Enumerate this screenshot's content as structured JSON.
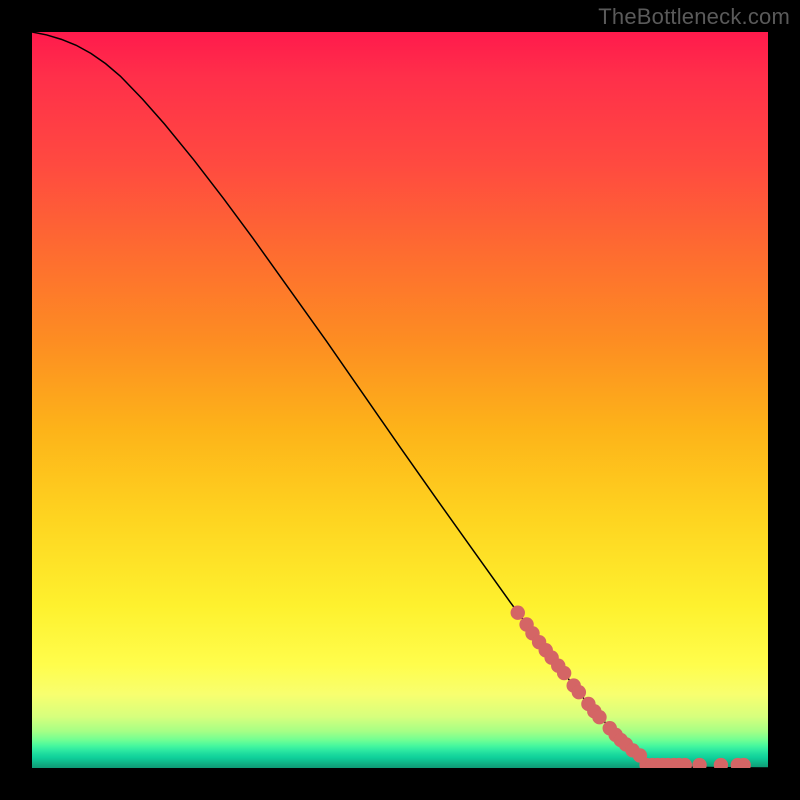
{
  "watermark": "TheBottleneck.com",
  "colors": {
    "dot": "#d46565",
    "line": "#000000",
    "background_black": "#000000"
  },
  "chart_data": {
    "type": "line",
    "title": "",
    "xlabel": "",
    "ylabel": "",
    "xlim": [
      0,
      100
    ],
    "ylim": [
      0,
      100
    ],
    "curve_points": [
      {
        "x": 0,
        "y": 100
      },
      {
        "x": 2,
        "y": 99.6
      },
      {
        "x": 4,
        "y": 99.0
      },
      {
        "x": 6,
        "y": 98.2
      },
      {
        "x": 8,
        "y": 97.1
      },
      {
        "x": 10,
        "y": 95.7
      },
      {
        "x": 12,
        "y": 94.0
      },
      {
        "x": 15,
        "y": 90.9
      },
      {
        "x": 18,
        "y": 87.5
      },
      {
        "x": 22,
        "y": 82.6
      },
      {
        "x": 26,
        "y": 77.4
      },
      {
        "x": 30,
        "y": 72.0
      },
      {
        "x": 35,
        "y": 65.0
      },
      {
        "x": 40,
        "y": 58.0
      },
      {
        "x": 45,
        "y": 50.8
      },
      {
        "x": 50,
        "y": 43.6
      },
      {
        "x": 55,
        "y": 36.5
      },
      {
        "x": 60,
        "y": 29.5
      },
      {
        "x": 65,
        "y": 22.5
      },
      {
        "x": 70,
        "y": 15.8
      },
      {
        "x": 75,
        "y": 9.4
      },
      {
        "x": 80,
        "y": 3.8
      },
      {
        "x": 82,
        "y": 2.0
      },
      {
        "x": 84,
        "y": 0.9
      },
      {
        "x": 86,
        "y": 0.35
      },
      {
        "x": 88,
        "y": 0.18
      },
      {
        "x": 90,
        "y": 0.1
      },
      {
        "x": 93,
        "y": 0.05
      },
      {
        "x": 96,
        "y": 0.02
      },
      {
        "x": 100,
        "y": 0
      }
    ],
    "series": [
      {
        "name": "scatter-upper-cluster",
        "type": "scatter",
        "values": [
          {
            "x": 66.0,
            "y": 21.1
          },
          {
            "x": 67.2,
            "y": 19.5
          },
          {
            "x": 68.0,
            "y": 18.3
          },
          {
            "x": 68.9,
            "y": 17.1
          },
          {
            "x": 69.8,
            "y": 16.0
          },
          {
            "x": 70.6,
            "y": 15.0
          },
          {
            "x": 71.5,
            "y": 13.9
          },
          {
            "x": 72.3,
            "y": 12.9
          },
          {
            "x": 73.6,
            "y": 11.2
          },
          {
            "x": 74.3,
            "y": 10.3
          },
          {
            "x": 75.6,
            "y": 8.7
          },
          {
            "x": 76.4,
            "y": 7.7
          },
          {
            "x": 77.1,
            "y": 6.9
          },
          {
            "x": 78.5,
            "y": 5.4
          },
          {
            "x": 79.3,
            "y": 4.5
          },
          {
            "x": 80.0,
            "y": 3.8
          },
          {
            "x": 80.7,
            "y": 3.2
          },
          {
            "x": 81.6,
            "y": 2.4
          },
          {
            "x": 82.6,
            "y": 1.7
          }
        ]
      },
      {
        "name": "scatter-lower-cluster",
        "type": "scatter",
        "values": [
          {
            "x": 83.5,
            "y": 0.4
          },
          {
            "x": 84.3,
            "y": 0.4
          },
          {
            "x": 85.0,
            "y": 0.4
          },
          {
            "x": 85.7,
            "y": 0.4
          },
          {
            "x": 86.4,
            "y": 0.4
          },
          {
            "x": 87.2,
            "y": 0.4
          },
          {
            "x": 87.9,
            "y": 0.4
          },
          {
            "x": 88.7,
            "y": 0.4
          },
          {
            "x": 90.7,
            "y": 0.4
          },
          {
            "x": 93.6,
            "y": 0.4
          },
          {
            "x": 95.9,
            "y": 0.4
          },
          {
            "x": 96.7,
            "y": 0.4
          }
        ]
      }
    ]
  }
}
